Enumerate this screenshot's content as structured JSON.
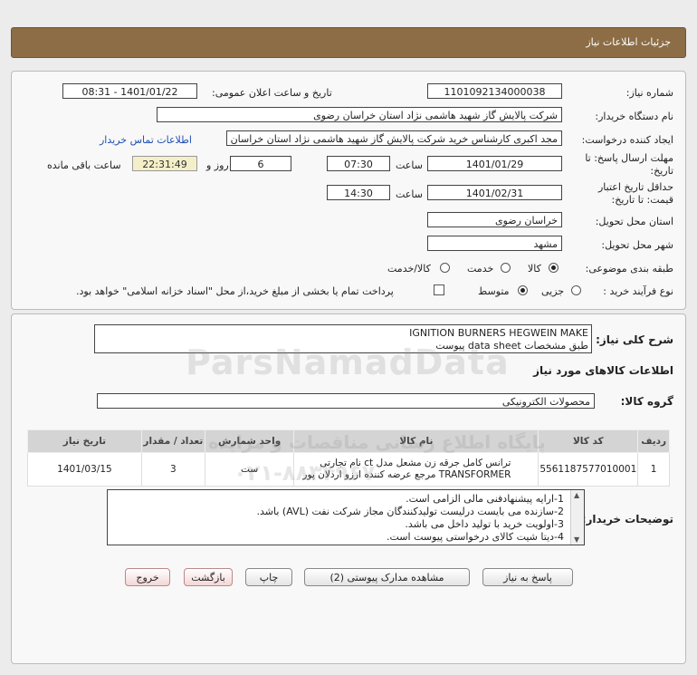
{
  "header": {
    "title": "جزئیات اطلاعات نیاز"
  },
  "form": {
    "need_no_label": "شماره نیاز:",
    "need_no": "1101092134000038",
    "announce_label": "تاریخ و ساعت اعلان عمومی:",
    "announce_value": "1401/01/22 - 08:31",
    "buyer_label": "نام دستگاه خریدار:",
    "buyer_value": "شرکت پالایش گاز شهید هاشمی نژاد   استان خراسان رضوی",
    "creator_label": "ایجاد کننده درخواست:",
    "creator_value": "مجد اکبری کارشناس خرید شرکت پالایش گاز شهید هاشمی نژاد   استان خراسان رضوی",
    "contact_link": "اطلاعات تماس خریدار",
    "deadline_label": "مهلت ارسال پاسخ: تا تاریخ:",
    "deadline_date": "1401/01/29",
    "time_label": "ساعت",
    "deadline_time": "07:30",
    "days_value": "6",
    "days_label": "روز و",
    "remaining_time": "22:31:49",
    "remaining_label": "ساعت باقی مانده",
    "validity_label": "حداقل تاریخ اعتبار قیمت: تا تاریخ:",
    "validity_date": "1401/02/31",
    "validity_time": "14:30",
    "province_label": "استان محل تحویل:",
    "province_value": "خراسان رضوی",
    "city_label": "شهر محل تحویل:",
    "city_value": "مشهد",
    "category_label": "طبقه بندی موضوعی:",
    "category_options": [
      "کالا",
      "خدمت",
      "کالا/خدمت"
    ],
    "process_label": "نوع فرآیند خرید :",
    "process_options": [
      "جزیی",
      "متوسط"
    ],
    "payment_note": "پرداخت تمام یا بخشی از مبلغ خرید،از محل \"اسناد خزانه اسلامی\" خواهد بود."
  },
  "details": {
    "summary_label": "شرح کلی نیاز:",
    "summary_line1": "IGNITION BURNERS HEGWEIN MAKE",
    "summary_line2": "طبق مشخصات data sheet پیوست",
    "goods_title": "اطلاعات کالاهای مورد نیاز",
    "group_label": "گروه کالا:",
    "group_value": "محصولات الکترونیکی",
    "table": {
      "headers": [
        "ردیف",
        "کد کالا",
        "نام کالا",
        "واحد شمارش",
        "تعداد / مقدار",
        "تاریخ نیاز"
      ],
      "rows": [
        {
          "row": "1",
          "code": "5561187577010001",
          "name_line1": "ترانس کامل جرقه زن مشعل مدل ct نام تجارتی",
          "name_line2": "TRANSFORMER مرجع عرضه کننده ارزو اردلان پور",
          "unit": "ست",
          "qty": "3",
          "date": "1401/03/15"
        }
      ]
    },
    "notes_label": "توضیحات خریدار:",
    "notes": [
      "1-ارایه پیشنهادفنی مالی الزامی است.",
      "2-سازنده می بایست درلیست تولیدکنندگان مجاز شرکت نفت (AVL)  باشد.",
      "3-اولویت خرید با  تولید داخل می باشد.",
      "4-دیتا شیت کالای درخواستی پیوست است."
    ]
  },
  "buttons": {
    "reply": "پاسخ به نیاز",
    "view_docs": "مشاهده مدارک پیوستی (2)",
    "print": "چاپ",
    "back": "بازگشت",
    "exit": "خروج"
  },
  "watermark": {
    "brand": "ParsNamadData",
    "line1": "پایگاه اطلاع رسانی مناقصات و مزایده",
    "phone": "۰۲۱-۸۸۳۴۹۶۷۰"
  }
}
